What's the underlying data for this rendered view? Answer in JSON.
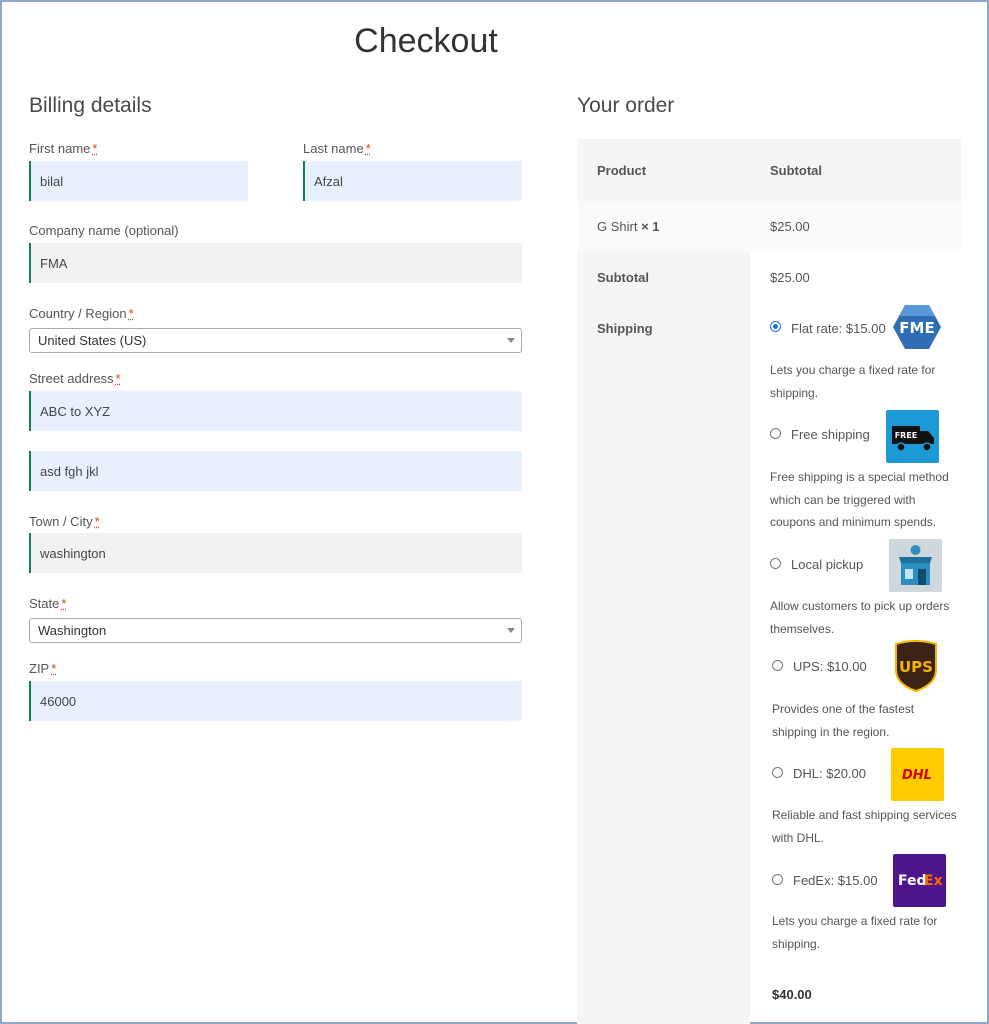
{
  "page_title": "Checkout",
  "billing": {
    "title": "Billing details",
    "first_name": {
      "label": "First name",
      "value": "bilal"
    },
    "last_name": {
      "label": "Last name",
      "value": "Afzal"
    },
    "company": {
      "label": "Company name (optional)",
      "value": "FMA"
    },
    "country": {
      "label": "Country / Region",
      "value": "United States (US)"
    },
    "street": {
      "label": "Street address",
      "line1": "ABC to XYZ",
      "line2": "asd fgh jkl"
    },
    "city": {
      "label": "Town / City",
      "value": "washington"
    },
    "state": {
      "label": "State",
      "value": "Washington"
    },
    "zip": {
      "label": "ZIP",
      "value": "46000"
    },
    "required_mark": "*"
  },
  "order": {
    "title": "Your order",
    "col_product": "Product",
    "col_subtotal": "Subtotal",
    "item_name": "G Shirt",
    "item_qty": "× 1",
    "item_price": "$25.00",
    "subtotal_label": "Subtotal",
    "subtotal_value": "$25.00",
    "shipping_label": "Shipping",
    "total_value": "$40.00",
    "shipping_options": [
      {
        "label": "Flat rate: $15.00",
        "desc": "Lets you charge a fixed rate for shipping.",
        "checked": true,
        "icon": "fme-logo-icon"
      },
      {
        "label": "Free shipping",
        "desc": "Free shipping is a special method which can be triggered with coupons and minimum spends.",
        "checked": false,
        "icon": "free-truck-icon"
      },
      {
        "label": "Local pickup",
        "desc": "Allow customers to pick up orders themselves.",
        "checked": false,
        "icon": "store-icon"
      },
      {
        "label": "UPS: $10.00",
        "desc": "Provides one of the fastest shipping in the region.",
        "checked": false,
        "icon": "ups-logo-icon"
      },
      {
        "label": "DHL: $20.00",
        "desc": "Reliable and fast shipping services with DHL.",
        "checked": false,
        "icon": "dhl-logo-icon"
      },
      {
        "label": "FedEx: $15.00",
        "desc": "Lets you charge a fixed rate for shipping.",
        "checked": false,
        "icon": "fedex-logo-icon"
      }
    ],
    "logo_text": {
      "free": "FREE",
      "ups": "UPS",
      "dhl": "DHL",
      "fedex_fed": "Fed",
      "fedex_ex": "Ex"
    }
  },
  "colors": {
    "autofill_bg": "#e8f0fe",
    "field_accent": "#0f834d",
    "required": "#e2401c",
    "radio": "#1a73e8"
  }
}
